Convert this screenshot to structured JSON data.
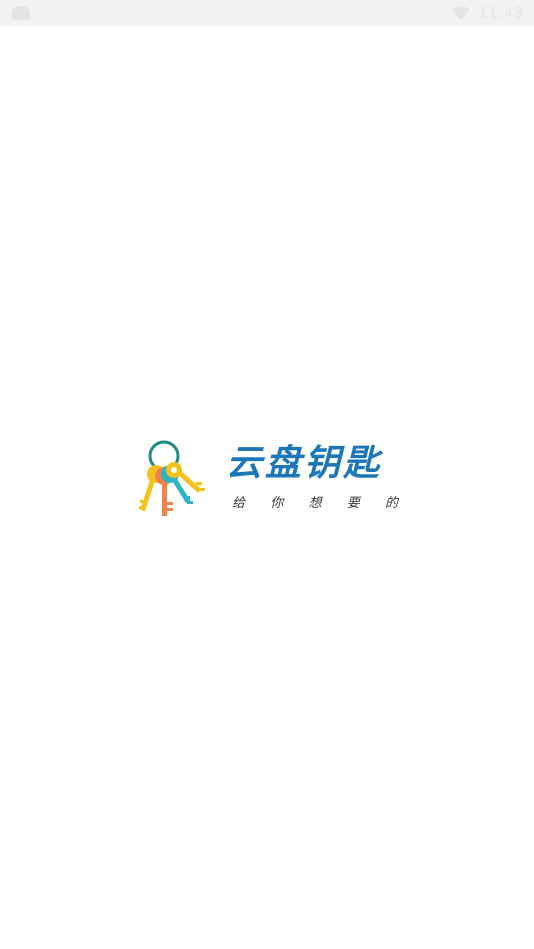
{
  "status_bar": {
    "left_icon": "android-notification-icon",
    "wifi_icon": "wifi-icon",
    "time": "11:43"
  },
  "splash": {
    "logo_icon": "keys-icon",
    "brand_name": "云盘钥匙",
    "slogan": [
      "给",
      "你",
      "想",
      "要",
      "的"
    ]
  },
  "colors": {
    "brand": "#1c76b8",
    "key_yellow": "#f5c21b",
    "key_orange": "#f0834a",
    "key_teal": "#2bb5c4",
    "ring": "#1d8a86"
  }
}
